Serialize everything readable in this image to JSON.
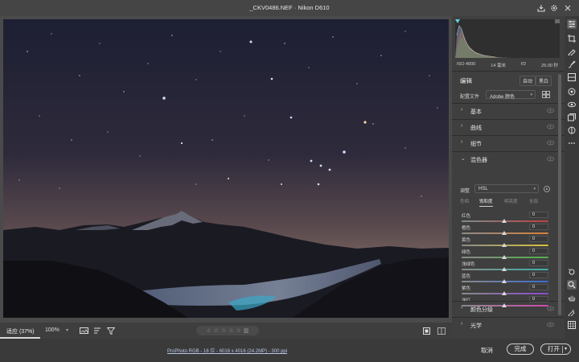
{
  "window": {
    "title": "_CKV0486.NEF  ·  Nikon D610"
  },
  "histogram": {
    "meta": [
      "ISO 4000",
      "14 毫米",
      "f/2",
      "25.00 秒"
    ]
  },
  "edit": {
    "title": "编辑",
    "auto_label": "自动",
    "bw_label": "黑白"
  },
  "profile": {
    "label": "配置文件",
    "value": "Adobe 颜色"
  },
  "sections": {
    "basic": "基本",
    "curve": "曲线",
    "detail": "细节",
    "mixer": "混色器",
    "grading": "颜色分级",
    "optics": "光学"
  },
  "mixer": {
    "adjust_label": "调整",
    "adjust_value": "HSL",
    "tabs": [
      "色相",
      "饱和度",
      "明亮度",
      "全部"
    ],
    "active_tab": 1,
    "rows": [
      {
        "name": "红色",
        "value": "0",
        "gradient": "linear-gradient(to right,#7a8c8c,#c04040)"
      },
      {
        "name": "橙色",
        "value": "0",
        "gradient": "linear-gradient(to right,#8a8a8a,#d7823a)"
      },
      {
        "name": "黄色",
        "value": "0",
        "gradient": "linear-gradient(to right,#8a8a8a,#d9c23a)"
      },
      {
        "name": "绿色",
        "value": "0",
        "gradient": "linear-gradient(to right,#8a8a8a,#52b04a)"
      },
      {
        "name": "浅绿色",
        "value": "0",
        "gradient": "linear-gradient(to right,#8a8a8a,#3ab0a8)"
      },
      {
        "name": "蓝色",
        "value": "0",
        "gradient": "linear-gradient(to right,#8a8a8a,#3a6ad0)"
      },
      {
        "name": "紫色",
        "value": "0",
        "gradient": "linear-gradient(to right,#8a8a8a,#8a4ad0)"
      },
      {
        "name": "洋红",
        "value": "0",
        "gradient": "linear-gradient(to right,#8a8a8a,#d04ab0)"
      }
    ]
  },
  "bottombar": {
    "zoom_fit": "适应 (37%)",
    "zoom_100": "100%"
  },
  "status": {
    "file_info": "ProPhoto RGB - 16 位 - 6016 x 4016 (24.2MP) - 300 ppi",
    "cancel_label": "取消",
    "done_label": "完成",
    "open_label": "打开"
  }
}
